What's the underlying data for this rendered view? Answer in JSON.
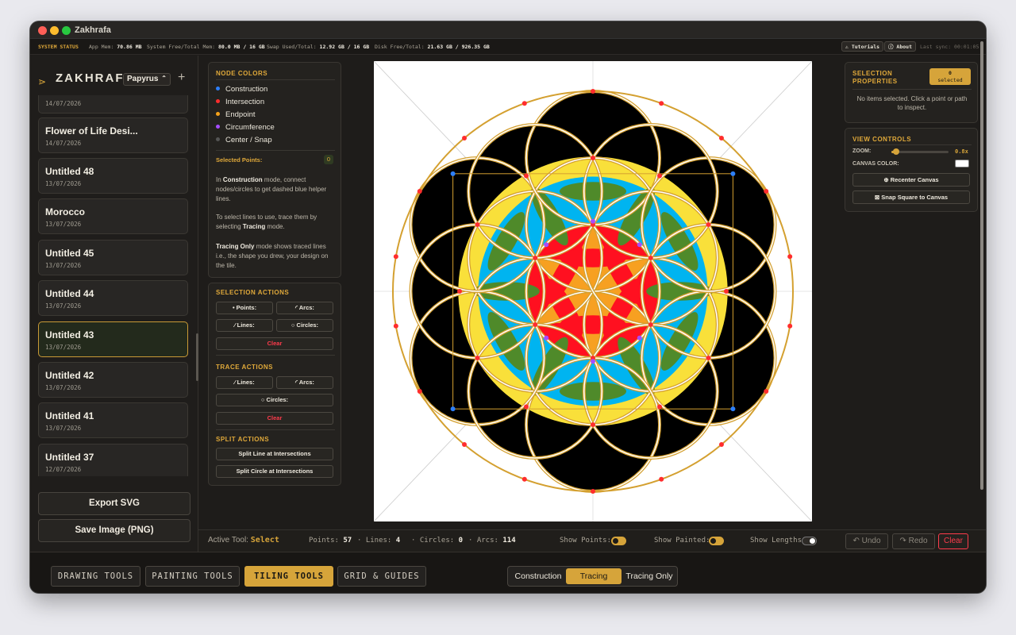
{
  "window": {
    "title": "Zakhrafa"
  },
  "status_bar": {
    "label": "SYSTEM STATUS",
    "app_mem_label": "App Mem:",
    "app_mem": "70.86 MB",
    "sys_mem_label": "System Free/Total Mem:",
    "sys_mem": "80.0 MB / 16 GB",
    "swap_label": "Swap Used/Total:",
    "swap": "12.92 GB / 16 GB",
    "disk_label": "Disk Free/Total:",
    "disk": "21.63 GB / 926.35 GB",
    "tutorials": "⚠ Tutorials",
    "about": "ⓘ About",
    "last_sync": "Last sync: 00:01:05"
  },
  "sidebar": {
    "brand": "ZAKHRAFA",
    "font_select": "Papyrus",
    "add": "+",
    "projects": [
      {
        "name": "",
        "date": "14/07/2026"
      },
      {
        "name": "Flower of Life Desi...",
        "date": "14/07/2026"
      },
      {
        "name": "Untitled 48",
        "date": "13/07/2026"
      },
      {
        "name": "Morocco",
        "date": "13/07/2026"
      },
      {
        "name": "Untitled 45",
        "date": "13/07/2026"
      },
      {
        "name": "Untitled 44",
        "date": "13/07/2026"
      },
      {
        "name": "Untitled 43",
        "date": "13/07/2026"
      },
      {
        "name": "Untitled 42",
        "date": "13/07/2026"
      },
      {
        "name": "Untitled 41",
        "date": "13/07/2026"
      },
      {
        "name": "Untitled 37",
        "date": "12/07/2026"
      }
    ],
    "export_svg": "Export SVG",
    "save_png": "Save Image (PNG)"
  },
  "tools": {
    "node_colors_title": "NODE COLORS",
    "legend": [
      {
        "label": "Construction",
        "color": "#2d7ff9"
      },
      {
        "label": "Intersection",
        "color": "#ff2d2d"
      },
      {
        "label": "Endpoint",
        "color": "#f6a21a"
      },
      {
        "label": "Circumference",
        "color": "#a64dff"
      },
      {
        "label": "Center / Snap",
        "color": "#555555"
      }
    ],
    "selected_points_label": "Selected Points:",
    "selected_points": "0",
    "help1_a": "In ",
    "help1_b": "Construction",
    "help1_c": " mode, connect nodes/circles to get dashed blue helper lines.",
    "help2_a": "To select lines to use, trace them by selecting ",
    "help2_b": "Tracing",
    "help2_c": " mode.",
    "help3_a": "Tracing Only",
    "help3_b": " mode shows traced lines i.e., the shape you drew, your design on the tile.",
    "selection_title": "SELECTION ACTIONS",
    "sel_points": "• Points:",
    "sel_arcs": "◜ Arcs:",
    "sel_lines": "⁄ Lines:",
    "sel_circles": "○ Circles:",
    "sel_clear": "Clear",
    "trace_title": "TRACE ACTIONS",
    "tr_lines": "⁄ Lines:",
    "tr_arcs": "◜ Arcs:",
    "tr_circles": "○ Circles:",
    "tr_clear": "Clear",
    "split_title": "SPLIT ACTIONS",
    "split_line": "Split Line at Intersections",
    "split_circle": "Split Circle at Intersections"
  },
  "canvas": {
    "colors": {
      "black": "#000000",
      "yellow": "#f9e03a",
      "blue": "#00b4f0",
      "green": "#4f8a2a",
      "red": "#ff1020",
      "orange": "#f7a021",
      "gold": "#d4a030"
    }
  },
  "right": {
    "sel_props_title": "SELECTION PROPERTIES",
    "selected_badge_count": "0",
    "selected_badge_label": "selected",
    "sel_props_msg": "No items selected. Click a point or path to inspect.",
    "view_title": "VIEW CONTROLS",
    "zoom_label": "ZOOM:",
    "zoom_value": "0.8x",
    "zoom_level": 0.08,
    "canvas_color_label": "CANVAS COLOR:",
    "canvas_color": "#ffffff",
    "recenter": "⊕ Recenter Canvas",
    "snap": "⊠ Snap Square to Canvas"
  },
  "bottom": {
    "active_tool_label": "Active Tool:",
    "active_tool": "Select",
    "points_label": "Points:",
    "points": "57",
    "lines_label": "Lines:",
    "lines": "4",
    "circles_label": "Circles:",
    "circles": "0",
    "arcs_label": "Arcs:",
    "arcs": "114",
    "show_points": "Show Points:",
    "show_painted": "Show Painted:",
    "show_lengths": "Show Lengths",
    "undo": "↶ Undo",
    "redo": "↷ Redo",
    "clear": "Clear"
  },
  "tabs": [
    "DRAWING TOOLS",
    "PAINTING TOOLS",
    "TILING TOOLS",
    "GRID & GUIDES"
  ],
  "modes": [
    "Construction",
    "Tracing",
    "Tracing Only"
  ]
}
